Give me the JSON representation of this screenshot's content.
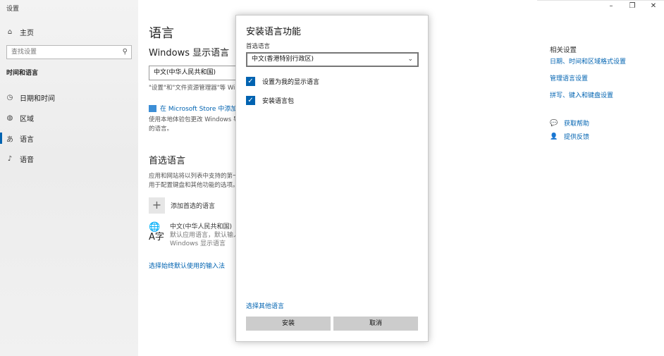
{
  "window": {
    "title": "设置",
    "minimize": "–",
    "restore": "❐",
    "close": "✕"
  },
  "sidebar": {
    "home": "主页",
    "search_placeholder": "查找设置",
    "section": "时间和语言",
    "items": [
      {
        "label": "日期和时间",
        "icon": "clock-icon",
        "glyph": "◷"
      },
      {
        "label": "区域",
        "icon": "globe-icon",
        "glyph": "◍"
      },
      {
        "label": "语言",
        "icon": "language-icon",
        "glyph": "あ"
      },
      {
        "label": "语音",
        "icon": "microphone-icon",
        "glyph": "🎙"
      }
    ]
  },
  "main": {
    "title": "语言",
    "display_heading": "Windows 显示语言",
    "display_value": "中文(中华人民共和国)",
    "display_desc": "\"设置\"和\"文件资源管理器\"等 Wi",
    "store_link": "在 Microsoft Store 中添加 W",
    "store_desc_1": "使用本地体验包更改 Windows 导",
    "store_desc_2": "的语言。",
    "preferred_heading": "首选语言",
    "preferred_desc_1": "应用和网站将以列表中支持的第一",
    "preferred_desc_2": "用于配置键盘和其他功能的选项。",
    "add_language": "添加首选的语言",
    "entry_name": "中文(中华人民共和国)",
    "entry_sub_1": "默认应用语言，默认输入语",
    "entry_sub_2": "Windows 显示语言",
    "input_link": "选择始终默认使用的输入法"
  },
  "related": {
    "title": "相关设置",
    "links": [
      "日期、时间和区域格式设置",
      "管理语言设置",
      "拼写、键入和键盘设置"
    ],
    "help": "获取帮助",
    "feedback": "提供反馈"
  },
  "dialog": {
    "title": "安装语言功能",
    "preferred_label": "首选语言",
    "selected_language": "中文(香港特别行政区)",
    "check_display": "设置为我的显示语言",
    "check_pack": "安装语言包",
    "other_link": "选择其他语言",
    "install": "安装",
    "cancel": "取消"
  },
  "colors": {
    "accent": "#0063b1",
    "button": "#cccccc"
  }
}
